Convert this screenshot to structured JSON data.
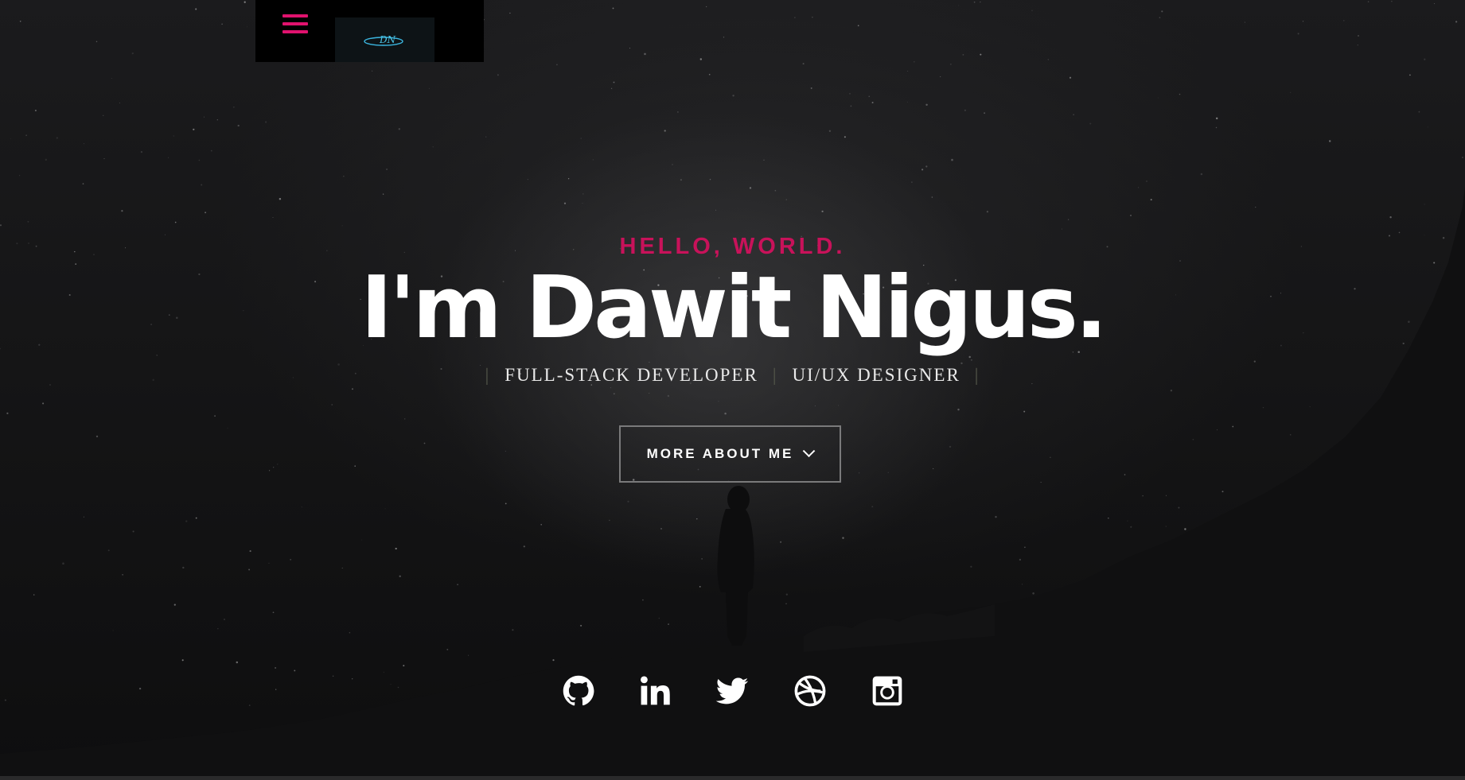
{
  "header": {
    "logo_text": "DN"
  },
  "intro": {
    "pretitle": "HELLO, WORLD.",
    "title": "I'm Dawit Nigus.",
    "roles": [
      "Full-Stack Developer",
      "UI/UX Designer"
    ],
    "separator": "|",
    "more_button": "MORE ABOUT ME"
  },
  "social": [
    {
      "name": "github",
      "icon": "github-icon"
    },
    {
      "name": "linkedin",
      "icon": "linkedin-icon"
    },
    {
      "name": "twitter",
      "icon": "twitter-icon"
    },
    {
      "name": "dribbble",
      "icon": "dribbble-icon"
    },
    {
      "name": "instagram",
      "icon": "instagram-icon"
    }
  ],
  "colors": {
    "accent": "#c8125a",
    "menu": "#e0126e",
    "text": "#ffffff",
    "background": "#0f0f10",
    "logo": "#4cc4e6"
  }
}
